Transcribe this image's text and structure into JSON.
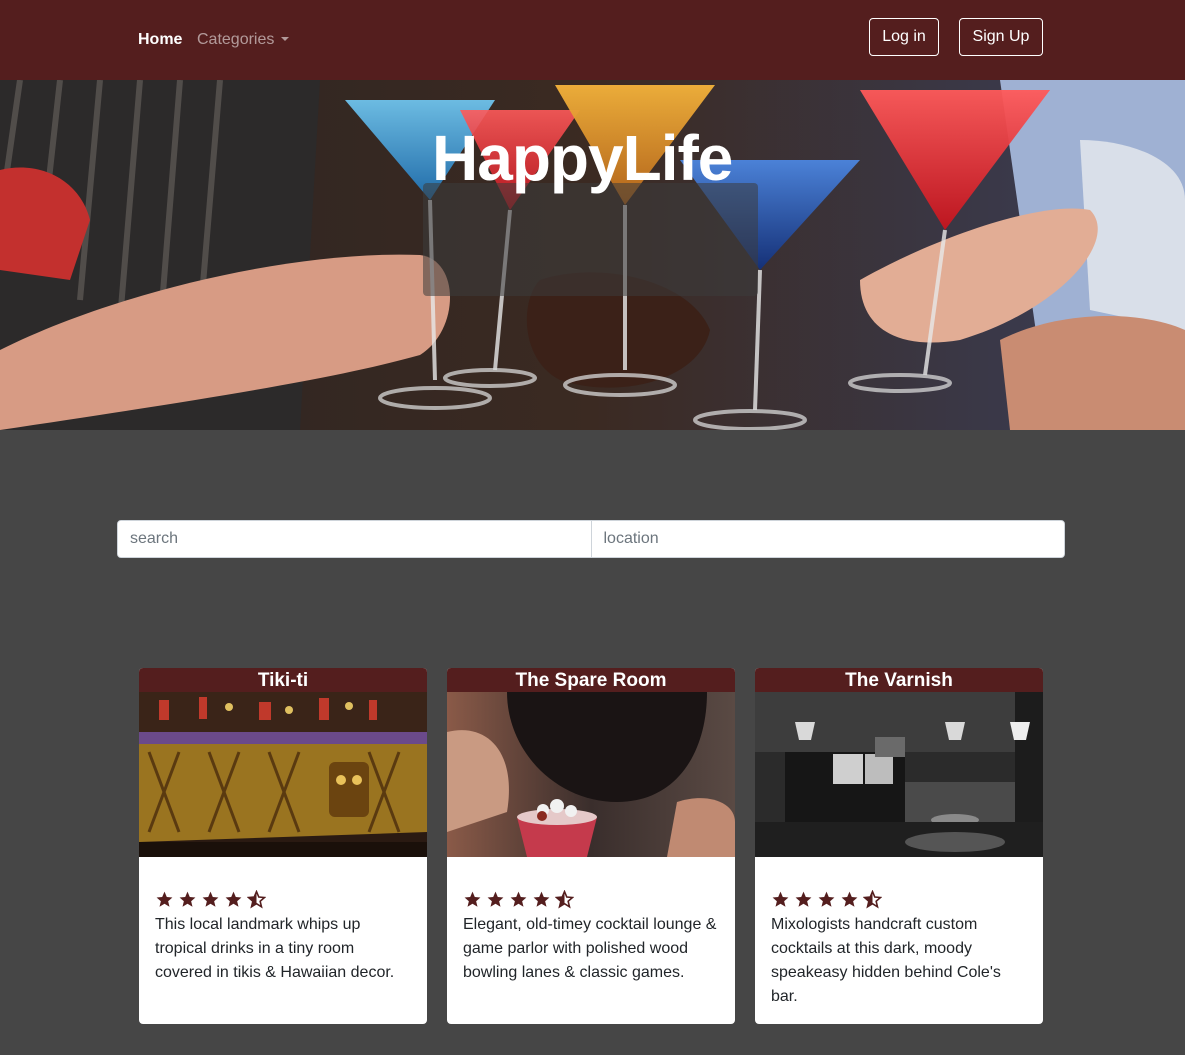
{
  "navbar": {
    "home": "Home",
    "categories": "Categories",
    "login": "Log in",
    "signup": "Sign Up"
  },
  "hero": {
    "title": "HappyLife"
  },
  "search": {
    "search_placeholder": "search",
    "location_placeholder": "location"
  },
  "cards": [
    {
      "title": "Tiki-ti",
      "rating": 4.5,
      "description": "This local landmark whips up tropical drinks in a tiny room covered in tikis & Hawaiian decor."
    },
    {
      "title": "The Spare Room",
      "rating": 4.5,
      "description": "Elegant, old-timey cocktail lounge & game parlor with polished wood bowling lanes & classic games."
    },
    {
      "title": "The Varnish",
      "rating": 4.5,
      "description": "Mixologists handcraft custom cocktails at this dark, moody speakeasy hidden behind Cole's bar."
    }
  ],
  "colors": {
    "brand": "#541e1e",
    "background": "#464646",
    "star": "#541e1e"
  },
  "icons": [
    "star-icon",
    "star-half-icon",
    "caret-down-icon"
  ]
}
